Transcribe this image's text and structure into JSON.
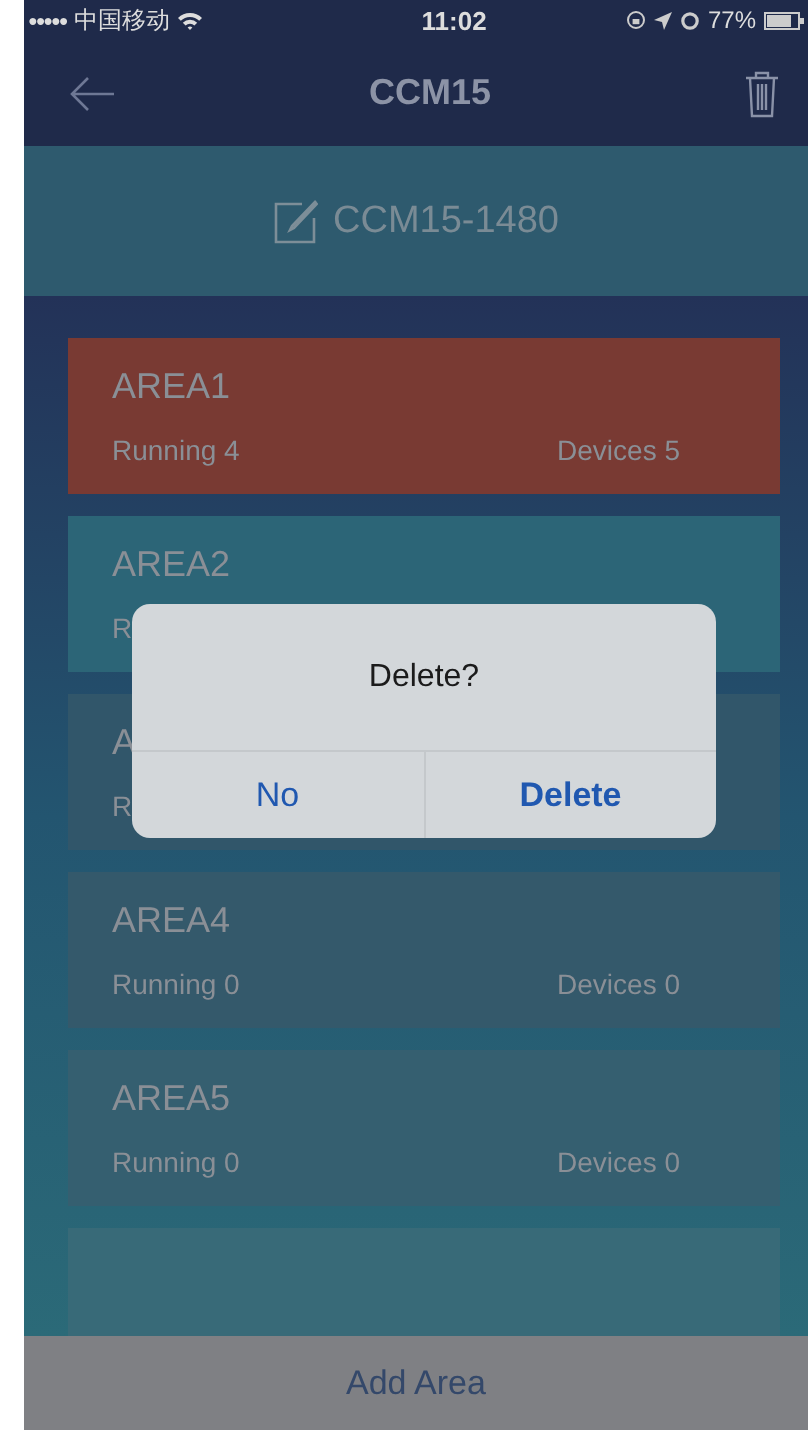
{
  "status_bar": {
    "signal": "●●●●●",
    "carrier": "中国移动",
    "time": "11:02",
    "battery": "77%"
  },
  "nav": {
    "title": "CCM15"
  },
  "header": {
    "name": "CCM15-1480"
  },
  "areas": [
    {
      "name": "AREA1",
      "running": "Running 4",
      "devices": "Devices 5",
      "color": "#793a33"
    },
    {
      "name": "AREA2",
      "running": "R",
      "color": "#2c6577"
    },
    {
      "name": "A",
      "running": "R",
      "color": "#31566a"
    },
    {
      "name": "AREA4",
      "running": "Running 0",
      "devices": "Devices 0",
      "color": "#34596b"
    },
    {
      "name": "AREA5",
      "running": "Running 0",
      "devices": "Devices 0",
      "color": "#355f70"
    },
    {
      "color": "#386a78"
    }
  ],
  "add_button": "Add Area",
  "dialog": {
    "title": "Delete?",
    "buttons": [
      {
        "label": "No",
        "kind": "cancel"
      },
      {
        "label": "Delete",
        "kind": "confirm"
      }
    ]
  }
}
